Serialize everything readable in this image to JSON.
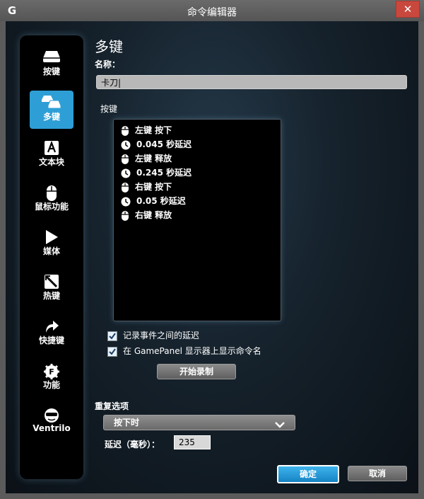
{
  "window": {
    "title": "命令编辑器",
    "logo": "G",
    "close_glyph": "✕"
  },
  "sidebar": {
    "items": [
      {
        "label": "按键",
        "icon": "key-icon",
        "active": false
      },
      {
        "label": "多键",
        "icon": "multikey-icon",
        "active": true
      },
      {
        "label": "文本块",
        "icon": "text-block-icon",
        "active": false
      },
      {
        "label": "鼠标功能",
        "icon": "mouse-icon",
        "active": false
      },
      {
        "label": "媒体",
        "icon": "play-icon",
        "active": false
      },
      {
        "label": "热键",
        "icon": "hotkey-icon",
        "active": false
      },
      {
        "label": "快捷键",
        "icon": "shortcut-arrow-icon",
        "active": false
      },
      {
        "label": "功能",
        "icon": "function-icon",
        "active": false
      },
      {
        "label": "Ventrilo",
        "icon": "ventrilo-headset-icon",
        "active": false
      }
    ]
  },
  "main": {
    "title": "多键",
    "name_label": "名称：",
    "name_value": "卡刀|",
    "keys_label": "按键",
    "events": [
      {
        "icon": "mouse-icon",
        "text": "左键 按下"
      },
      {
        "icon": "clock-icon",
        "text": "0.045 秒延迟"
      },
      {
        "icon": "mouse-icon",
        "text": "左键 释放"
      },
      {
        "icon": "clock-icon",
        "text": "0.245 秒延迟"
      },
      {
        "icon": "mouse-icon",
        "text": "右键 按下"
      },
      {
        "icon": "clock-icon",
        "text": "0.05 秒延迟"
      },
      {
        "icon": "mouse-icon",
        "text": "右键 释放"
      }
    ],
    "checkboxes": [
      {
        "label": "记录事件之间的延迟",
        "checked": true
      },
      {
        "label": "在 GamePanel 显示器上显示命令名",
        "checked": true
      }
    ],
    "record_button": "开始录制",
    "repeat_label": "重复选项",
    "repeat_value": "按下时",
    "delay_label": "延迟（毫秒）：",
    "delay_value": "235",
    "ok_button": "确定",
    "cancel_button": "取消"
  },
  "colors": {
    "accent": "#2e9fd6",
    "close": "#c9483e",
    "sidebar_bg": "#000000"
  }
}
